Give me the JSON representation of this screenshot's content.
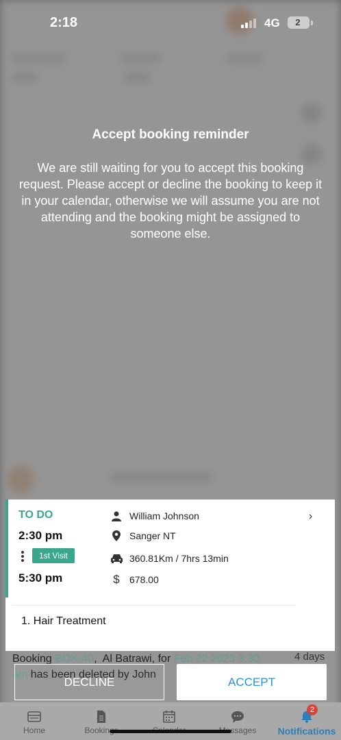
{
  "status_bar": {
    "time": "2:18",
    "network": "4G",
    "battery": "2"
  },
  "reminder": {
    "title": "Accept booking reminder",
    "message": "We are still waiting for you to accept this booking request. Please accept or decline the booking to keep it in your calendar, otherwise we will assume you are not attending and the booking might be assigned to someone else."
  },
  "booking": {
    "status": "TO DO",
    "start_time": "2:30 pm",
    "visit_badge": "1st Visit",
    "end_time": "5:30 pm",
    "client_name": "William Johnson",
    "location": "Sanger  NT",
    "distance": "360.81Km / 7hrs 13min",
    "price": "678.00",
    "service": "1. Hair Treatment",
    "accent_color": "#3aa68e"
  },
  "background_notification": {
    "prefix": "Booking",
    "booking_ref": "BOK-40",
    "client": "Al Batrawi, for",
    "date": "Feb 22 2023 3:30",
    "suffix_link": "am",
    "rest": "has been deleted by John",
    "age": "4 days"
  },
  "actions": {
    "decline_label": "DECLINE",
    "accept_label": "ACCEPT",
    "accept_color": "#2a93d5"
  },
  "tabs": [
    {
      "label": "Home",
      "icon": "home-icon"
    },
    {
      "label": "Bookings",
      "icon": "document-icon"
    },
    {
      "label": "Calendar",
      "icon": "calendar-icon"
    },
    {
      "label": "Messages",
      "icon": "chat-icon"
    },
    {
      "label": "Notifications",
      "icon": "bell-icon",
      "active": true,
      "badge": "2"
    }
  ]
}
